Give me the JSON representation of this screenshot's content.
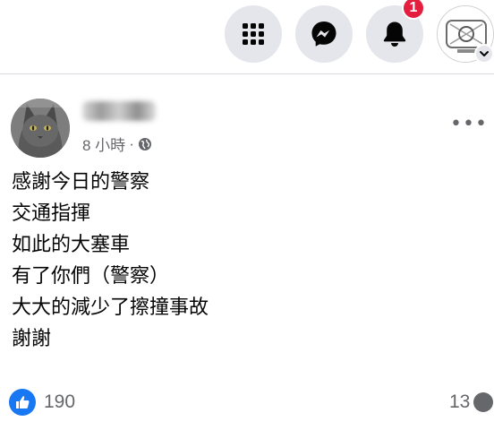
{
  "topbar": {
    "menu_icon": "grid-menu-icon",
    "messenger_icon": "messenger-icon",
    "notifications_icon": "bell-icon",
    "notifications_badge": "1",
    "account_icon": "account-avatar",
    "account_caret_icon": "chevron-down-icon",
    "badge_color": "#e41e3f",
    "button_bg": "#e4e6eb"
  },
  "post": {
    "author_avatar": "cat-avatar",
    "time": "8 小時",
    "separator": "·",
    "privacy_icon": "globe-icon",
    "more_icon": "more-horizontal-icon",
    "more_label": "•••",
    "lines": [
      "感謝今日的警察",
      "交通指揮",
      "如此的大塞車",
      "有了你們（警察）",
      "大大的減少了擦撞事故",
      "謝謝"
    ],
    "reactions": {
      "icon": "like-icon",
      "count": "190",
      "color": "#1877f2"
    },
    "comments": {
      "count": "13",
      "icon": "comment-icon"
    }
  }
}
